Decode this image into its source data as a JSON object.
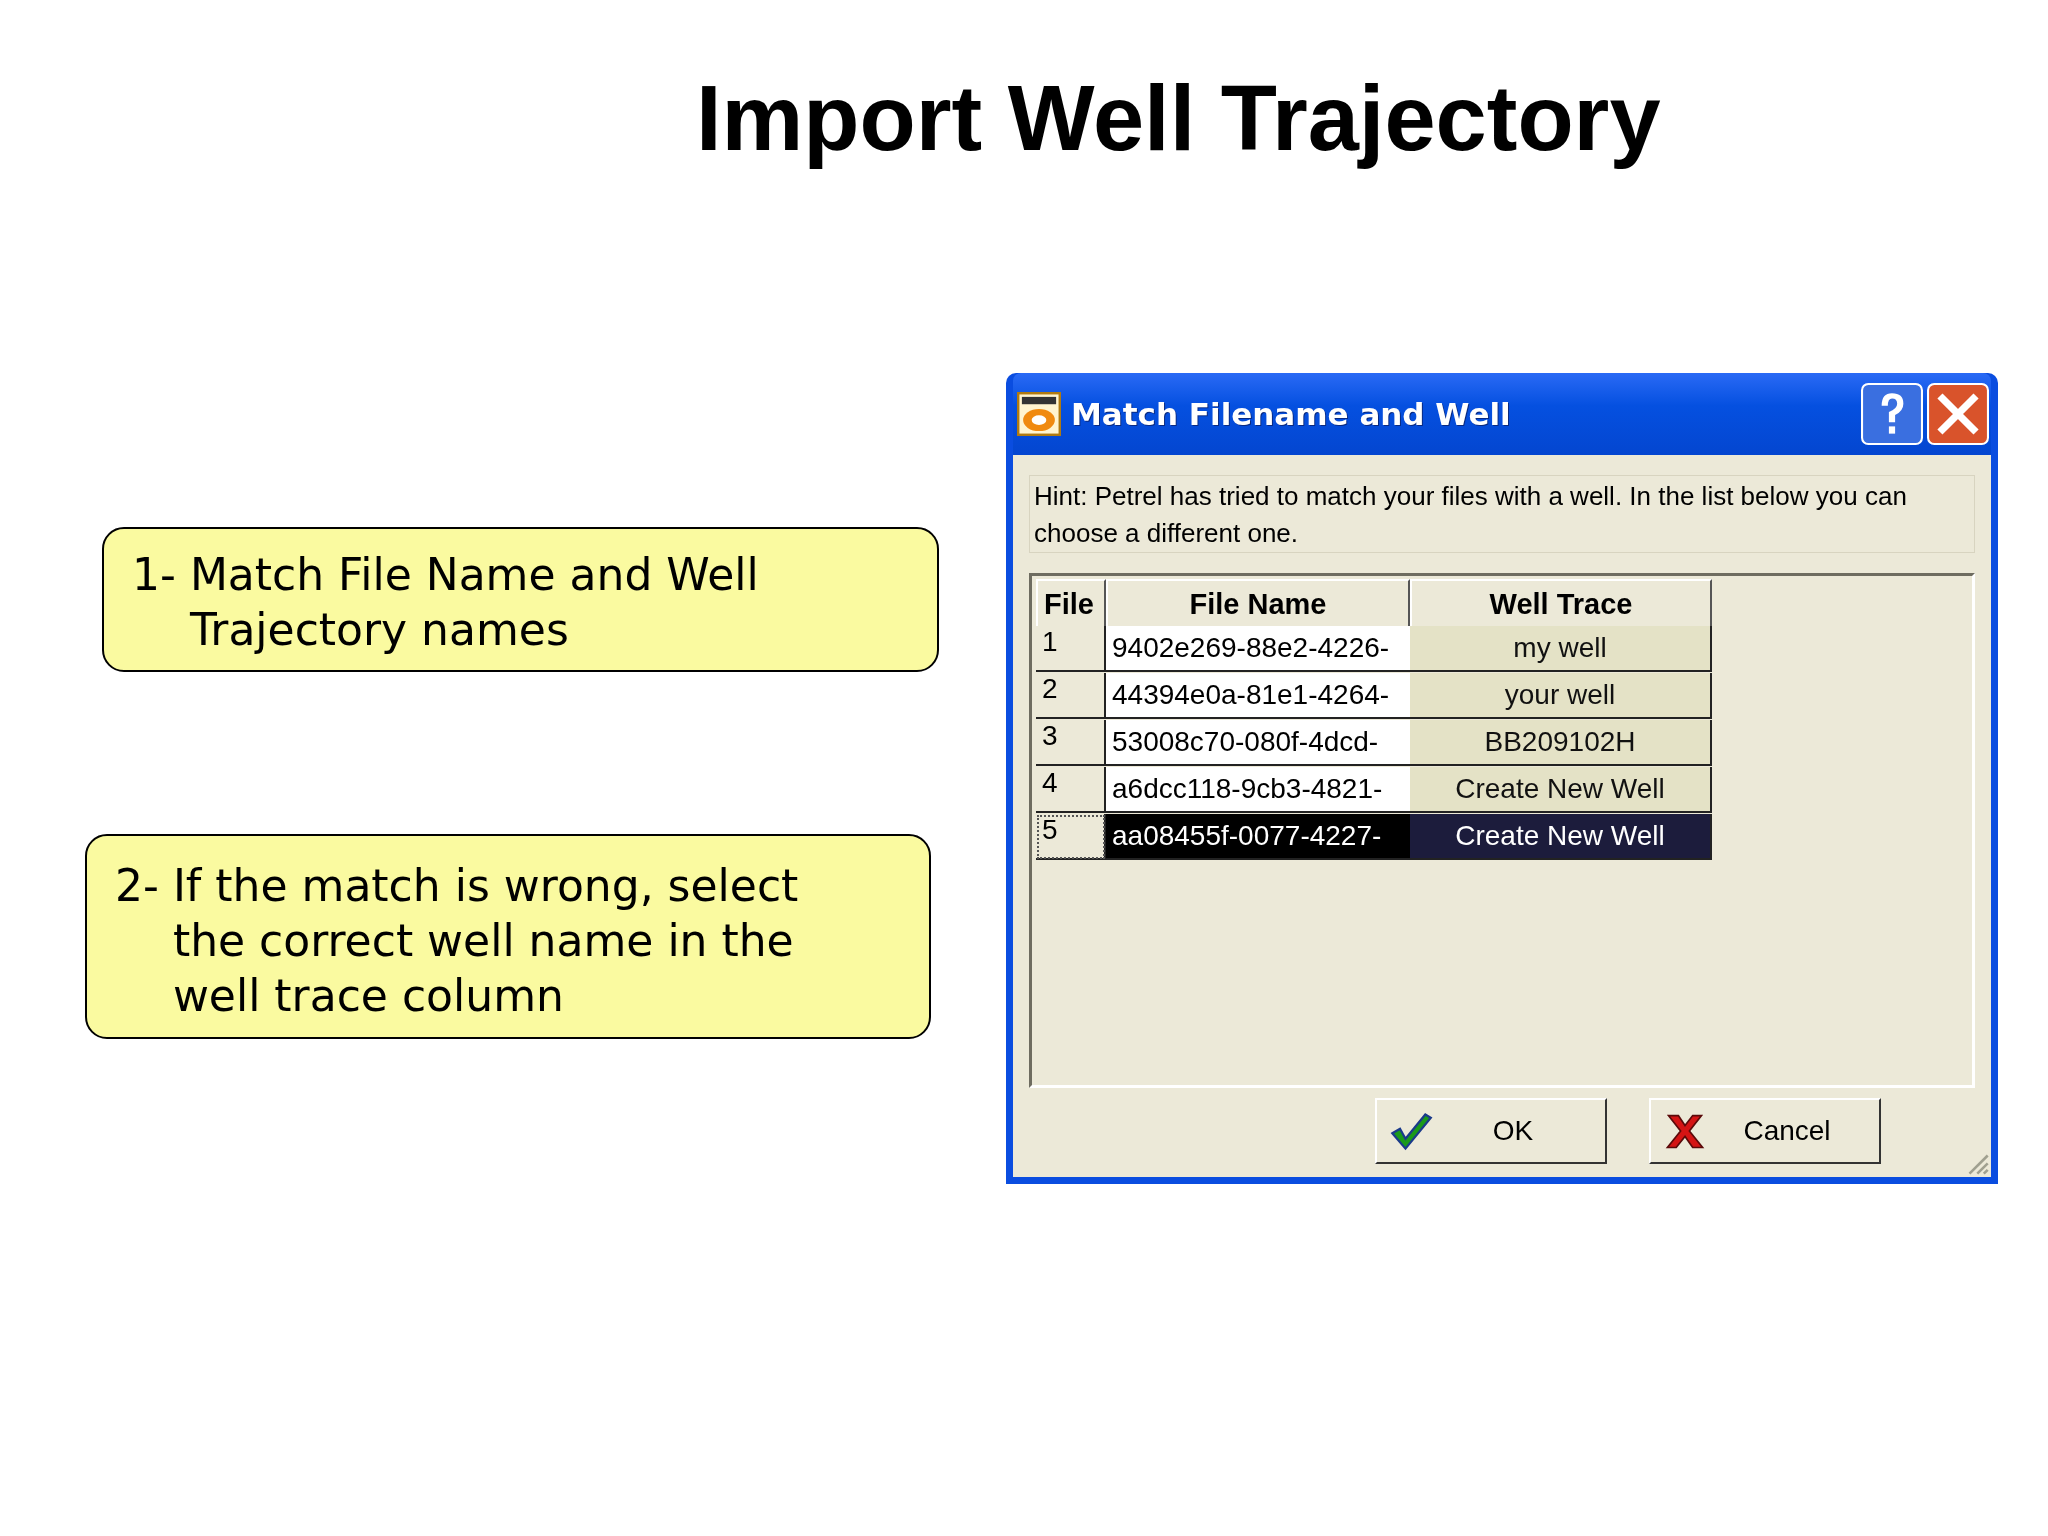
{
  "slide_title": "Import Well Trajectory",
  "callouts": [
    {
      "number": "1-",
      "text": "Match File Name and Well Trajectory names"
    },
    {
      "number": "2-",
      "text": "If the match is wrong, select the correct well name in the well trace column"
    }
  ],
  "dialog": {
    "title": "Match Filename and Well",
    "hint": "Hint:  Petrel has tried to match your files with a well.  In the list below you can choose a different one.",
    "table": {
      "columns": [
        "File",
        "File Name",
        "Well Trace"
      ],
      "rows": [
        {
          "file": "1",
          "file_name": "9402e269-88e2-4226-",
          "well_trace": "my well",
          "selected": false
        },
        {
          "file": "2",
          "file_name": "44394e0a-81e1-4264-",
          "well_trace": "your well",
          "selected": false
        },
        {
          "file": "3",
          "file_name": "53008c70-080f-4dcd-",
          "well_trace": "BB209102H",
          "selected": false
        },
        {
          "file": "4",
          "file_name": "a6dcc118-9cb3-4821-",
          "well_trace": "Create New Well",
          "selected": false
        },
        {
          "file": "5",
          "file_name": "aa08455f-0077-4227-",
          "well_trace": "Create New Well",
          "selected": true
        }
      ]
    },
    "buttons": [
      {
        "kind": "ok",
        "label": "OK"
      },
      {
        "kind": "cancel",
        "label": "Cancel"
      }
    ]
  }
}
